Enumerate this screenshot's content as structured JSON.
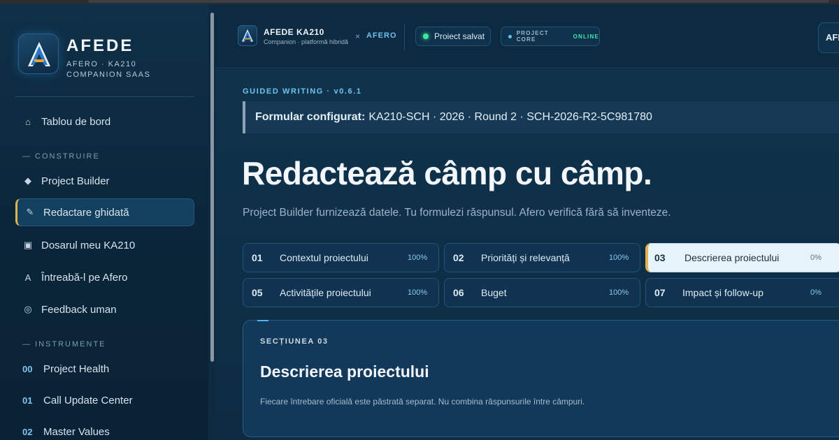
{
  "sidebar": {
    "brand_title": "AFEDE",
    "brand_sub_1": "AFERO · KA210",
    "brand_sub_2": "COMPANION SAAS",
    "dashboard": {
      "icon": "home-icon",
      "label": "Tablou de bord"
    },
    "section_build": "— CONSTRUIRE",
    "build_items": [
      {
        "icon": "diamond-icon",
        "label": "Project Builder"
      },
      {
        "icon": "pencil-icon",
        "label": "Redactare ghidată",
        "active": true
      },
      {
        "icon": "folder-icon",
        "label": "Dosarul meu KA210"
      },
      {
        "icon": "letter-a-icon",
        "label": "Întreabă-l pe Afero"
      },
      {
        "icon": "feedback-icon",
        "label": "Feedback uman"
      }
    ],
    "section_tools": "— INSTRUMENTE",
    "tool_items": [
      {
        "num": "00",
        "label": "Project Health"
      },
      {
        "num": "01",
        "label": "Call Update Center"
      },
      {
        "num": "02",
        "label": "Master Values"
      }
    ]
  },
  "topbar": {
    "app_title": "AFEDE KA210",
    "app_sub": "Companion · platformă hibridă",
    "separator": "×",
    "partner": "AFERO",
    "saved_status": "Proiect salvat",
    "core_label": "PROJECT CORE",
    "core_status": "ONLINE",
    "profile_initials": "AFE",
    "colors": {
      "online": "#47e3a8",
      "saved_dot": "#3ee89a",
      "accent": "#6ec4ef",
      "active_marker": "#e0b450"
    }
  },
  "main": {
    "eyebrow": "GUIDED WRITING · v0.6.1",
    "config_label": "Formular configurat:",
    "config_value": "KA210-SCH · 2026 · Round 2 · SCH-2026-R2-5C981780",
    "headline": "Redactează câmp cu câmp.",
    "lead": "Project Builder furnizează datele. Tu formulezi răspunsul. Afero verifică fără să inventeze.",
    "steps": [
      {
        "num": "01",
        "title": "Contextul proiectului",
        "progress": "100%"
      },
      {
        "num": "02",
        "title": "Priorități și relevanță",
        "progress": "100%"
      },
      {
        "num": "03",
        "title": "Descrierea proiectului",
        "progress": "0%",
        "current": true
      },
      {
        "num": "05",
        "title": "Activitățile proiectului",
        "progress": "100%"
      },
      {
        "num": "06",
        "title": "Buget",
        "progress": "100%"
      },
      {
        "num": "07",
        "title": "Impact și follow-up",
        "progress": "0%"
      }
    ],
    "section": {
      "eyebrow": "SECȚIUNEA 03",
      "title": "Descrierea proiectului",
      "note": "Fiecare întrebare oficială este păstrată separat. Nu combina răspunsurile între câmpuri."
    }
  }
}
